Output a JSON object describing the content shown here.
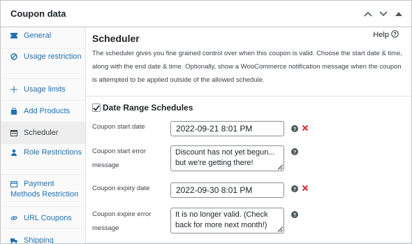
{
  "panel": {
    "title": "Coupon data"
  },
  "sidebar": {
    "items": [
      {
        "label": "General",
        "icon": "ticket-icon"
      },
      {
        "label": "Usage restriction",
        "icon": "block-icon"
      },
      {
        "label": "Usage limits",
        "icon": "limits-icon"
      },
      {
        "label": "Add Products",
        "icon": "bag-icon"
      },
      {
        "label": "Scheduler",
        "icon": "calendar-icon"
      },
      {
        "label": "Role Restrictions",
        "icon": "person-icon"
      },
      {
        "label": "Payment Methods Restriction",
        "icon": "payment-icon"
      },
      {
        "label": "URL Coupons",
        "icon": "link-icon"
      },
      {
        "label": "Shipping",
        "icon": "truck-icon"
      }
    ],
    "active": "Scheduler"
  },
  "main": {
    "title": "Scheduler",
    "help_label": "Help",
    "description": "The scheduler gives you fine grained control over when this coupon is valid. Choose the start date & time, along with the end date & time. Optionally, show a WooCommerce notification message when the coupon is attempted to be applied outside of the allowed schedule.",
    "checkbox_label": "Date Range Schedules",
    "fields": {
      "start_date_label": "Coupon start date",
      "start_date_value": "2022-09-21 8:01 PM",
      "start_error_label": "Coupon start error message",
      "start_error_value": "Discount has not yet begun... but we're getting there!",
      "expiry_date_label": "Coupon expiry date",
      "expiry_date_value": "2022-09-30 8:01 PM",
      "expire_error_label": "Coupon expire error message",
      "expire_error_value": "It is no longer valid. (Check back for more next month!)"
    }
  },
  "colors": {
    "link": "#2271b1",
    "delete": "#d63638",
    "text": "#1d2327"
  }
}
